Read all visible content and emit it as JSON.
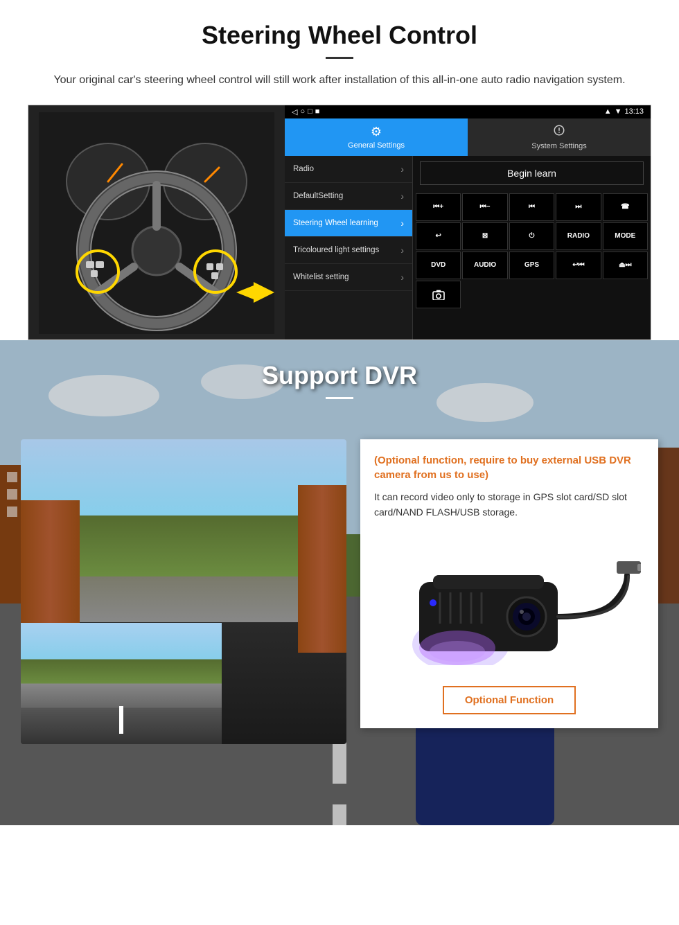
{
  "steering_section": {
    "title": "Steering Wheel Control",
    "subtitle": "Your original car's steering wheel control will still work after installation of this all-in-one auto radio navigation system.",
    "status_bar": {
      "time": "13:13",
      "signal": "▼",
      "wifi": "▼",
      "battery": "■"
    },
    "nav_bar": {
      "back": "◁",
      "home": "○",
      "recents": "□",
      "menu": "■"
    },
    "tabs": [
      {
        "id": "general",
        "icon": "⚙",
        "label": "General Settings",
        "active": true
      },
      {
        "id": "system",
        "icon": "⚡",
        "label": "System Settings",
        "active": false
      }
    ],
    "menu_items": [
      {
        "label": "Radio",
        "active": false
      },
      {
        "label": "DefaultSetting",
        "active": false
      },
      {
        "label": "Steering Wheel learning",
        "active": true
      },
      {
        "label": "Tricoloured light settings",
        "active": false
      },
      {
        "label": "Whitelist setting",
        "active": false
      }
    ],
    "begin_learn_label": "Begin learn",
    "control_buttons": [
      {
        "icon": "⏮+",
        "label": "⏮+"
      },
      {
        "icon": "⏮−",
        "label": "⏮−"
      },
      {
        "icon": "⏮",
        "label": "⏮"
      },
      {
        "icon": "⏭",
        "label": "⏭"
      },
      {
        "icon": "☎",
        "label": "☎"
      },
      {
        "icon": "↩",
        "label": "↩"
      },
      {
        "icon": "🔇",
        "label": "⊠"
      },
      {
        "icon": "⏻",
        "label": "⏻"
      },
      {
        "icon": "RADIO",
        "label": "RADIO"
      },
      {
        "icon": "MODE",
        "label": "MODE"
      },
      {
        "icon": "DVD",
        "label": "DVD"
      },
      {
        "icon": "AUDIO",
        "label": "AUDIO"
      },
      {
        "icon": "GPS",
        "label": "GPS"
      },
      {
        "icon": "⏎⏮",
        "label": "↩⏮"
      },
      {
        "icon": "⏏⏭",
        "label": "⏏⏭"
      },
      {
        "icon": "📷",
        "label": "📷"
      }
    ]
  },
  "dvr_section": {
    "title": "Support DVR",
    "info_title": "(Optional function, require to buy external USB DVR camera from us to use)",
    "info_text": "It can record video only to storage in GPS slot card/SD slot card/NAND FLASH/USB storage.",
    "optional_button_label": "Optional Function"
  }
}
